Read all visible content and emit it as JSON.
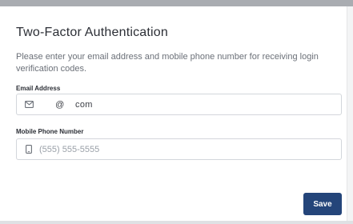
{
  "dialog": {
    "title": "Two-Factor Authentication",
    "description": "Please enter your email address and mobile phone number for receiving login verification codes.",
    "save_label": "Save"
  },
  "email": {
    "label": "Email Address",
    "value": "      @    com",
    "icon": "envelope-icon"
  },
  "phone": {
    "label": "Mobile Phone Number",
    "placeholder": "(555) 555-5555",
    "value": "",
    "icon": "mobile-phone-icon"
  },
  "colors": {
    "primary_button": "#24457a",
    "title_text": "#2c2f36",
    "muted_text": "#6b7078",
    "input_border": "#d3d6db"
  }
}
